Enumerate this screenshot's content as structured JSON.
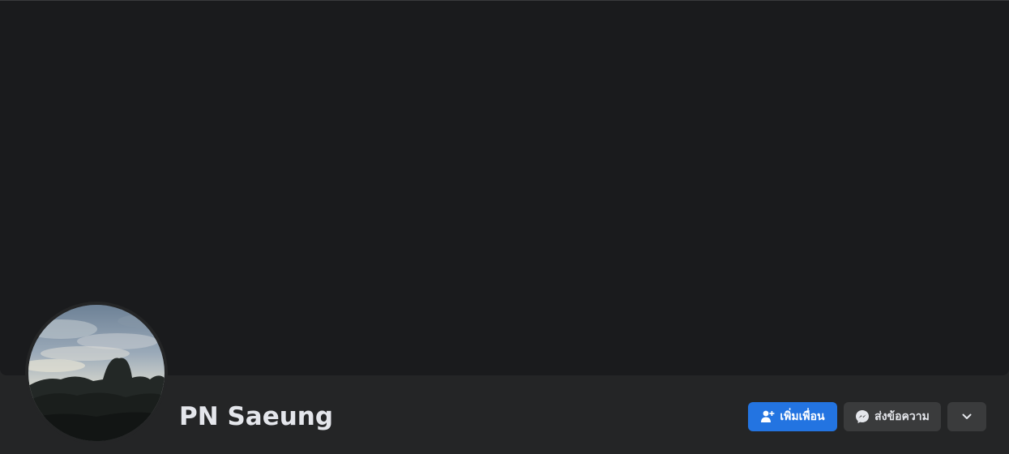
{
  "profile": {
    "name": "PN Saeung"
  },
  "actions": {
    "add_friend_label": "เพิ่มเพื่อน",
    "message_label": "ส่งข้อความ",
    "more_icon": "chevron-down-icon"
  },
  "icons": {
    "add_friend": "person-add-icon",
    "message": "messenger-icon"
  },
  "colors": {
    "primary": "#2374e1",
    "secondary_button": "#3a3b3c",
    "cover": "#1a1b1d",
    "header_bg": "#242526",
    "text": "#e4e6eb"
  }
}
